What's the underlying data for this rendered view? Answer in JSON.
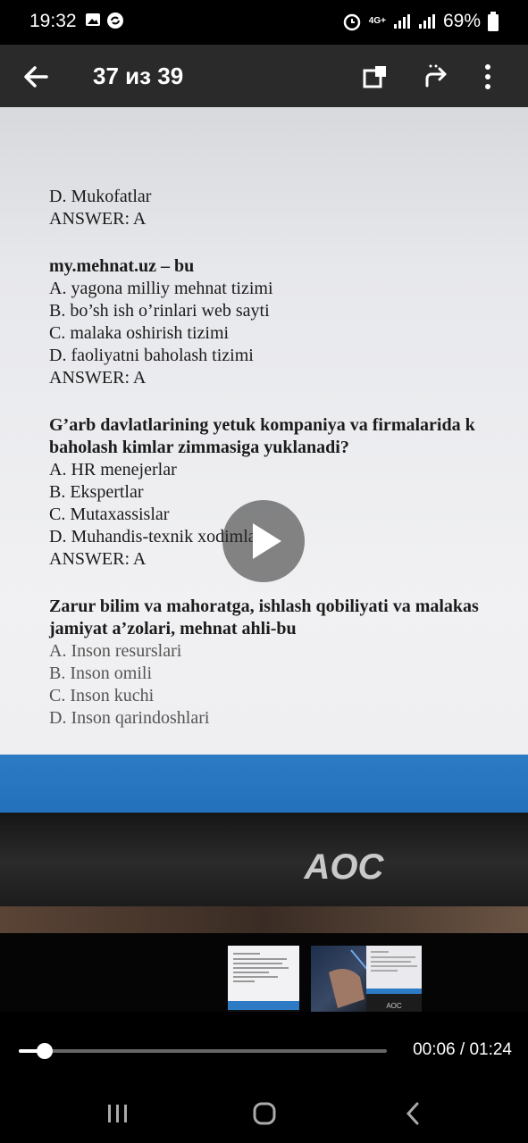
{
  "status_bar": {
    "time": "19:32",
    "network": "4G+",
    "battery": "69%"
  },
  "toolbar": {
    "counter": "37 из 39"
  },
  "document": {
    "lines": [
      {
        "text": "D. Mukofatlar",
        "style": "normal"
      },
      {
        "text": "ANSWER: A",
        "style": "normal"
      },
      {
        "text": "",
        "style": "gap"
      },
      {
        "text": "my.mehnat.uz – bu",
        "style": "q"
      },
      {
        "text": "A. yagona milliy mehnat tizimi",
        "style": "normal"
      },
      {
        "text": "B. bo’sh ish o’rinlari web sayti",
        "style": "normal"
      },
      {
        "text": "C. malaka oshirish tizimi",
        "style": "normal"
      },
      {
        "text": "D. faoliyatni baholash tizimi",
        "style": "normal"
      },
      {
        "text": "ANSWER: A",
        "style": "normal"
      },
      {
        "text": "",
        "style": "gap"
      },
      {
        "text": "G’arb davlatlarining yetuk kompaniya va firmalarida k",
        "style": "q"
      },
      {
        "text": "baholash kimlar zimmasiga yuklanadi?",
        "style": "q"
      },
      {
        "text": "A. HR menejerlar",
        "style": "normal"
      },
      {
        "text": "B. Ekspertlar",
        "style": "normal"
      },
      {
        "text": "C. Mutaxassislar",
        "style": "normal"
      },
      {
        "text": "D. Muhandis-texnik xodimlar",
        "style": "normal"
      },
      {
        "text": "ANSWER: A",
        "style": "normal"
      },
      {
        "text": "",
        "style": "gap"
      },
      {
        "text": "Zarur bilim va mahoratga, ishlash qobiliyati va malakas",
        "style": "q"
      },
      {
        "text": "jamiyat a’zolari, mehnat ahli-bu",
        "style": "q"
      },
      {
        "text": "A. Inson resurslari",
        "style": "faded"
      },
      {
        "text": "B. Inson omili",
        "style": "faded"
      },
      {
        "text": "C. Inson kuchi",
        "style": "faded"
      },
      {
        "text": "D. Inson qarindoshlari",
        "style": "faded"
      }
    ]
  },
  "monitor_brand": "AOC",
  "player": {
    "current_time": "00:06",
    "separator": " / ",
    "total_time": "01:24",
    "progress": 0.071
  },
  "thumbnails": [
    "thumb-document",
    "thumb-video-hand",
    "thumb-document-monitor"
  ],
  "icons": [
    "back-arrow-icon",
    "copy-icon",
    "share-icon",
    "more-icon",
    "play-icon",
    "recent-apps-icon",
    "home-icon",
    "nav-back-icon"
  ]
}
